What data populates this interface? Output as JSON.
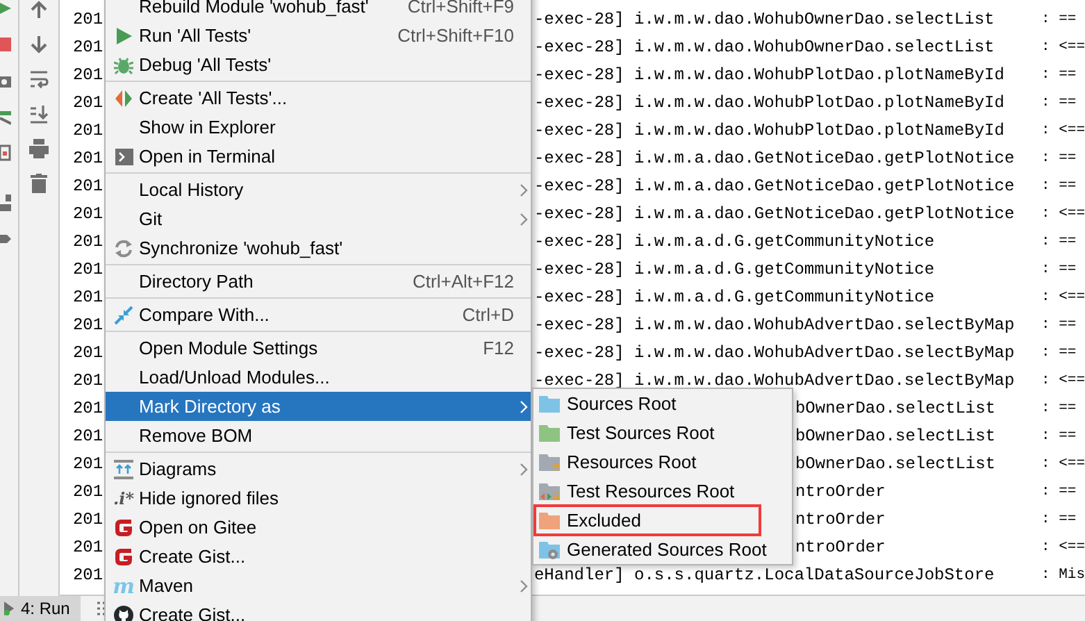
{
  "console": {
    "rows": [
      {
        "date": "201",
        "kind": "full",
        "text": "-exec-28] i.w.m.w.dao.WohubOwnerDao.selectList",
        "marker": ": =="
      },
      {
        "date": "201",
        "kind": "full",
        "text": "-exec-28] i.w.m.w.dao.WohubOwnerDao.selectList",
        "marker": ": <=="
      },
      {
        "date": "201",
        "kind": "full",
        "text": "-exec-28] i.w.m.w.dao.WohubPlotDao.plotNameById",
        "marker": ": =="
      },
      {
        "date": "201",
        "kind": "full",
        "text": "-exec-28] i.w.m.w.dao.WohubPlotDao.plotNameById",
        "marker": ": =="
      },
      {
        "date": "201",
        "kind": "full",
        "text": "-exec-28] i.w.m.w.dao.WohubPlotDao.plotNameById",
        "marker": ": <=="
      },
      {
        "date": "201",
        "kind": "full",
        "text": "-exec-28] i.w.m.a.dao.GetNoticeDao.getPlotNotice",
        "marker": ": =="
      },
      {
        "date": "201",
        "kind": "full",
        "text": "-exec-28] i.w.m.a.dao.GetNoticeDao.getPlotNotice",
        "marker": ": =="
      },
      {
        "date": "201",
        "kind": "full",
        "text": "-exec-28] i.w.m.a.dao.GetNoticeDao.getPlotNotice",
        "marker": ": <=="
      },
      {
        "date": "201",
        "kind": "full",
        "text": "-exec-28] i.w.m.a.d.G.getCommunityNotice",
        "marker": ": =="
      },
      {
        "date": "201",
        "kind": "full",
        "text": "-exec-28] i.w.m.a.d.G.getCommunityNotice",
        "marker": ": =="
      },
      {
        "date": "201",
        "kind": "full",
        "text": "-exec-28] i.w.m.a.d.G.getCommunityNotice",
        "marker": ": <=="
      },
      {
        "date": "201",
        "kind": "full",
        "text": "-exec-28] i.w.m.w.dao.WohubAdvertDao.selectByMap",
        "marker": ": =="
      },
      {
        "date": "201",
        "kind": "full",
        "text": "-exec-28] i.w.m.w.dao.WohubAdvertDao.selectByMap",
        "marker": ": =="
      },
      {
        "date": "201",
        "kind": "full",
        "text": "-exec-28] i.w.m.w.dao.WohubAdvertDao.selectByMap",
        "marker": ": <=="
      },
      {
        "date": "201",
        "kind": "partial",
        "text": "bOwnerDao.selectList",
        "marker": ": =="
      },
      {
        "date": "201",
        "kind": "partial",
        "text": "bOwnerDao.selectList",
        "marker": ": =="
      },
      {
        "date": "201",
        "kind": "partial",
        "text": "bOwnerDao.selectList",
        "marker": ": <=="
      },
      {
        "date": "201",
        "kind": "partial",
        "text": "ntroOrder",
        "marker": ": =="
      },
      {
        "date": "201",
        "kind": "partial",
        "text": "ntroOrder",
        "marker": ": =="
      },
      {
        "date": "201",
        "kind": "partial",
        "text": "ntroOrder",
        "marker": ": <=="
      },
      {
        "date": "201",
        "kind": "full",
        "text": "eHandler] o.s.s.quartz.LocalDataSourceJobStore",
        "marker": ": Mis"
      }
    ]
  },
  "context_menu": {
    "items": [
      {
        "kind": "item",
        "label": "Rebuild Module 'wohub_fast'",
        "shortcut": "Ctrl+Shift+F9",
        "submenu": false,
        "selected": false
      },
      {
        "kind": "item",
        "label": "Run 'All Tests'",
        "shortcut": "Ctrl+Shift+F10",
        "submenu": false,
        "selected": false
      },
      {
        "kind": "item",
        "label": "Debug 'All Tests'",
        "submenu": false,
        "selected": false
      },
      {
        "kind": "separator"
      },
      {
        "kind": "item",
        "label": "Create 'All Tests'...",
        "submenu": false,
        "selected": false
      },
      {
        "kind": "item",
        "label": "Show in Explorer",
        "submenu": false,
        "selected": false
      },
      {
        "kind": "item",
        "label": "Open in Terminal",
        "submenu": false,
        "selected": false
      },
      {
        "kind": "separator"
      },
      {
        "kind": "item",
        "label": "Local History",
        "submenu": true,
        "selected": false
      },
      {
        "kind": "item",
        "label": "Git",
        "submenu": true,
        "selected": false
      },
      {
        "kind": "item",
        "label": "Synchronize 'wohub_fast'",
        "submenu": false,
        "selected": false
      },
      {
        "kind": "separator"
      },
      {
        "kind": "item",
        "label": "Directory Path",
        "shortcut": "Ctrl+Alt+F12",
        "submenu": false,
        "selected": false
      },
      {
        "kind": "separator"
      },
      {
        "kind": "item",
        "label": "Compare With...",
        "shortcut": "Ctrl+D",
        "submenu": false,
        "selected": false
      },
      {
        "kind": "separator"
      },
      {
        "kind": "item",
        "label": "Open Module Settings",
        "shortcut": "F12",
        "submenu": false,
        "selected": false
      },
      {
        "kind": "item",
        "label": "Load/Unload Modules...",
        "submenu": false,
        "selected": false
      },
      {
        "kind": "item",
        "label": "Mark Directory as",
        "submenu": true,
        "selected": true
      },
      {
        "kind": "item",
        "label": "Remove BOM",
        "submenu": false,
        "selected": false
      },
      {
        "kind": "separator"
      },
      {
        "kind": "item",
        "label": "Diagrams",
        "submenu": true,
        "selected": false
      },
      {
        "kind": "item",
        "label": "Hide ignored files",
        "icon_text": ".i*",
        "submenu": false,
        "selected": false
      },
      {
        "kind": "item",
        "label": "Open on Gitee",
        "submenu": false,
        "selected": false
      },
      {
        "kind": "item",
        "label": "Create Gist...",
        "submenu": false,
        "selected": false
      },
      {
        "kind": "item",
        "label": "Maven",
        "icon_text": "m",
        "submenu": true,
        "selected": false
      },
      {
        "kind": "item",
        "label": "Create Gist...",
        "submenu": false,
        "selected": false
      }
    ]
  },
  "submenu": {
    "items": [
      {
        "label": "Sources Root",
        "color": "#7ec3e6",
        "outlined": false
      },
      {
        "label": "Test Sources Root",
        "color": "#8fc383",
        "outlined": false
      },
      {
        "label": "Resources Root",
        "color": "#a2a9b0",
        "outlined": false
      },
      {
        "label": "Test Resources Root",
        "color": "#a2a9b0",
        "outlined": false
      },
      {
        "label": "Excluded",
        "color": "#f0a27a",
        "outlined": true
      },
      {
        "label": "Generated Sources Root",
        "color": "#7ec3e6",
        "outlined": false
      }
    ]
  },
  "bottom_tabs": [
    {
      "label": "4: Run",
      "selected": true
    }
  ]
}
